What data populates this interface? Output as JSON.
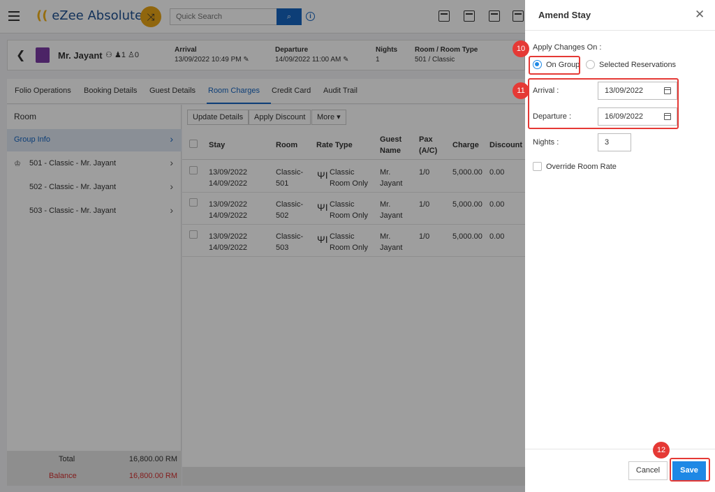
{
  "app": {
    "logo": "eZee Absolute",
    "search_placeholder": "Quick Search"
  },
  "reservation": {
    "guest_name": "Mr. Jayant",
    "adults": "1",
    "children": "0",
    "arrival_label": "Arrival",
    "arrival_value": "13/09/2022 10:49 PM",
    "departure_label": "Departure",
    "departure_value": "14/09/2022 11:00 AM",
    "nights_label": "Nights",
    "nights_value": "1",
    "room_label": "Room / Room Type",
    "room_value": "501 / Classic"
  },
  "tabs": [
    "Folio Operations",
    "Booking Details",
    "Guest Details",
    "Room Charges",
    "Credit Card",
    "Audit Trail"
  ],
  "active_tab": "Room Charges",
  "left_panel": {
    "title": "Room",
    "group": "Group Info",
    "rooms": [
      "501 - Classic - Mr. Jayant",
      "502 - Classic - Mr. Jayant",
      "503 - Classic - Mr. Jayant"
    ],
    "total_label": "Total",
    "total_value": "16,800.00 RM",
    "balance_label": "Balance",
    "balance_value": "16,800.00 RM"
  },
  "toolbar": {
    "update": "Update Details",
    "discount": "Apply Discount",
    "more": "More"
  },
  "table": {
    "headers": {
      "stay": "Stay",
      "room": "Room",
      "rate_type": "Rate Type",
      "guest_name_1": "Guest",
      "guest_name_2": "Name",
      "pax_1": "Pax",
      "pax_2": "(A/C)",
      "charge": "Charge",
      "discount": "Discount"
    },
    "rows": [
      {
        "stay_1": "13/09/2022",
        "stay_2": "14/09/2022",
        "room_1": "Classic-",
        "room_2": "501",
        "rate_1": "Classic",
        "rate_2": "Room Only",
        "guest_1": "Mr.",
        "guest_2": "Jayant",
        "pax": "1/0",
        "charge": "5,000.00",
        "discount": "0.00"
      },
      {
        "stay_1": "13/09/2022",
        "stay_2": "14/09/2022",
        "room_1": "Classic-",
        "room_2": "502",
        "rate_1": "Classic",
        "rate_2": "Room Only",
        "guest_1": "Mr.",
        "guest_2": "Jayant",
        "pax": "1/0",
        "charge": "5,000.00",
        "discount": "0.00"
      },
      {
        "stay_1": "13/09/2022",
        "stay_2": "14/09/2022",
        "room_1": "Classic-",
        "room_2": "503",
        "rate_1": "Classic",
        "rate_2": "Room Only",
        "guest_1": "Mr.",
        "guest_2": "Jayant",
        "pax": "1/0",
        "charge": "5,000.00",
        "discount": "0.00"
      }
    ]
  },
  "drawer": {
    "title": "Amend Stay",
    "apply_label": "Apply Changes On :",
    "option_group": "On Group",
    "option_selected": "Selected Reservations",
    "arrival_label": "Arrival :",
    "arrival_value": "13/09/2022",
    "departure_label": "Departure :",
    "departure_value": "16/09/2022",
    "nights_label": "Nights :",
    "nights_value": "3",
    "override_label": "Override Room Rate",
    "cancel": "Cancel",
    "save": "Save"
  },
  "callouts": {
    "step_10": "10",
    "step_11": "11",
    "step_12": "12"
  },
  "colors": {
    "primary": "#1e88e5",
    "callout": "#e53935",
    "brand": "#1d4f91"
  }
}
